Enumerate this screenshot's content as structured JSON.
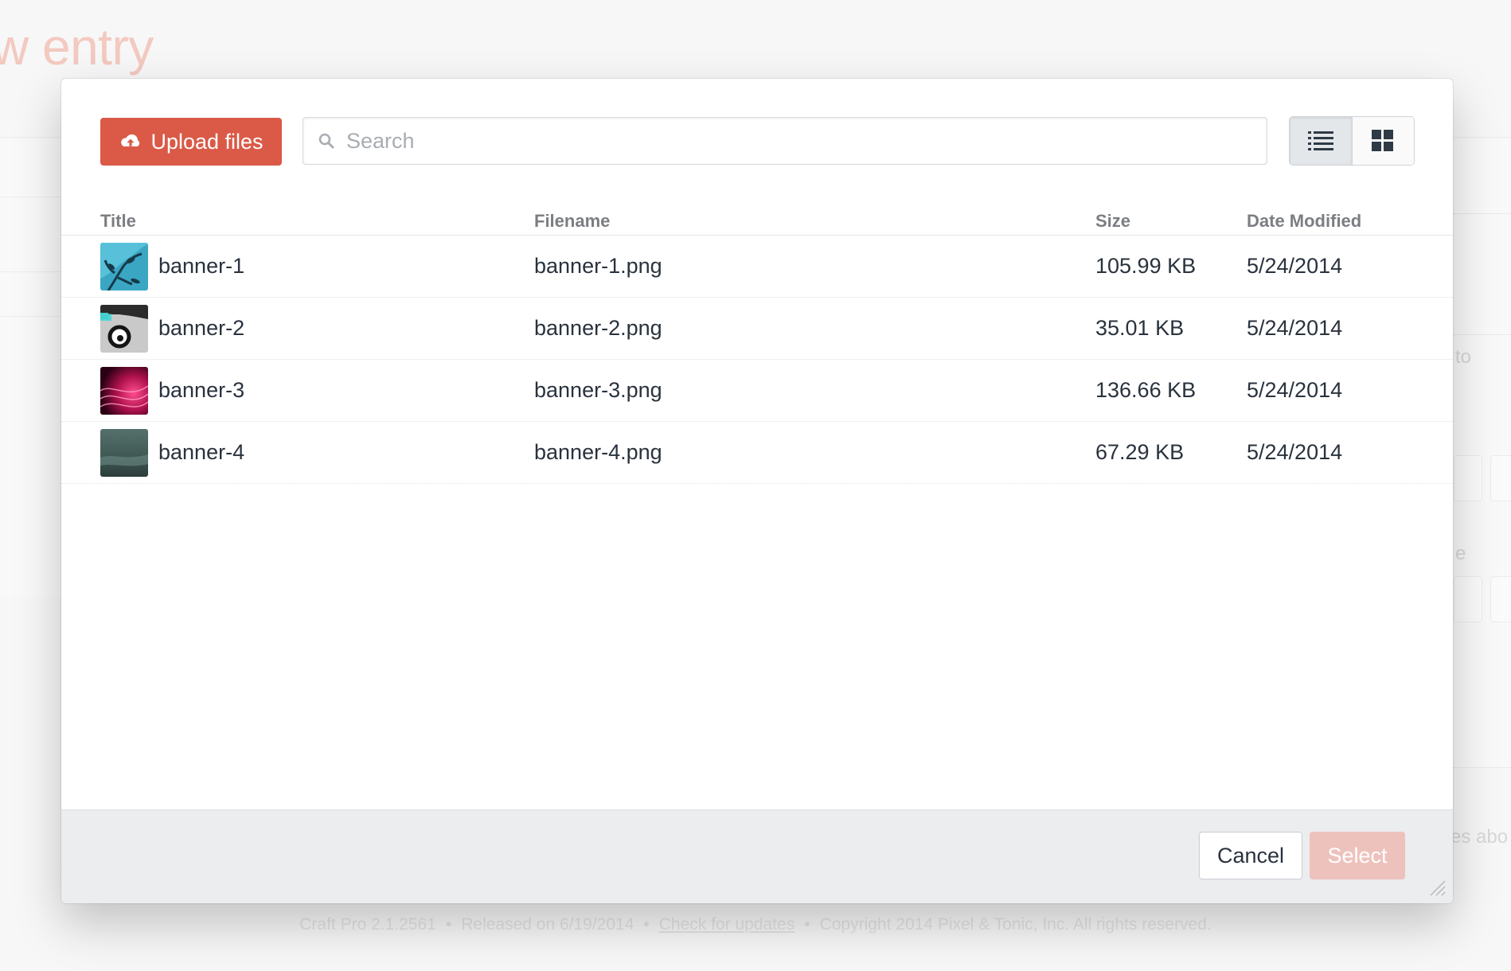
{
  "background": {
    "page_title": "w entry",
    "right_labels": [
      "to",
      "e",
      "es abo"
    ],
    "footer": {
      "version": "Craft Pro 2.1.2561",
      "released": "Released on 6/19/2014",
      "update_link": "Check for updates",
      "copyright": "Copyright 2014 Pixel & Tonic, Inc. All rights reserved.",
      "separator": "•"
    }
  },
  "toolbar": {
    "upload_label": "Upload files",
    "upload_icon": "cloud-upload-icon",
    "search_placeholder": "Search",
    "search_value": "",
    "view_modes": [
      {
        "icon": "list-view-icon",
        "active": true
      },
      {
        "icon": "grid-view-icon",
        "active": false
      }
    ]
  },
  "table": {
    "columns": [
      "Title",
      "Filename",
      "Size",
      "Date Modified"
    ],
    "rows": [
      {
        "title": "banner-1",
        "filename": "banner-1.png",
        "size": "105.99 KB",
        "date": "5/24/2014"
      },
      {
        "title": "banner-2",
        "filename": "banner-2.png",
        "size": "35.01 KB",
        "date": "5/24/2014"
      },
      {
        "title": "banner-3",
        "filename": "banner-3.png",
        "size": "136.66 KB",
        "date": "5/24/2014"
      },
      {
        "title": "banner-4",
        "filename": "banner-4.png",
        "size": "67.29 KB",
        "date": "5/24/2014"
      }
    ]
  },
  "footer": {
    "cancel_label": "Cancel",
    "select_label": "Select"
  },
  "colors": {
    "accent": "#da5a47",
    "select_disabled": "#eec2bc"
  }
}
